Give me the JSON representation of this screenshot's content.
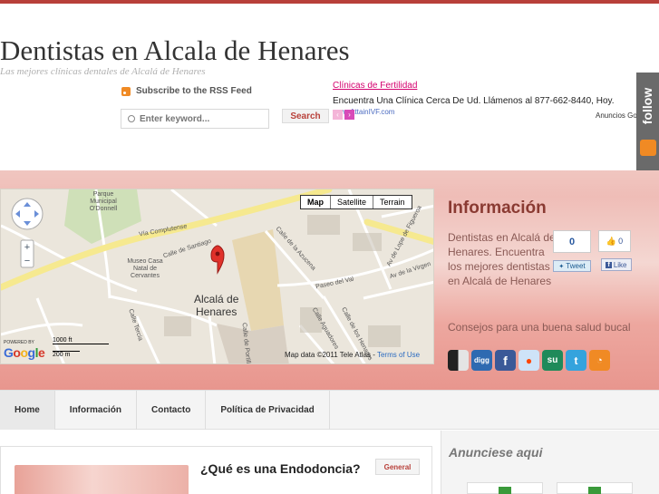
{
  "site": {
    "title": "Dentistas en Alcala de Henares",
    "tagline": "Las mejores clínicas dentales de Alcalá de Henares"
  },
  "header": {
    "rss_label": "Subscribe to the RSS Feed",
    "search_placeholder": "Enter keyword...",
    "search_button": "Search"
  },
  "ad": {
    "title": "Clínicas de Fertilidad",
    "text": "Encuentra Una Clínica Cerca De Ud. Llámenos al 877-662-8440, Hoy.",
    "url": "www.AttainIVF.com",
    "label": "Anuncios Google"
  },
  "follow": {
    "label": "follow"
  },
  "map": {
    "type_buttons": [
      "Map",
      "Satellite",
      "Terrain"
    ],
    "city": [
      "Alcalá de",
      "Henares"
    ],
    "labels": {
      "park": "Parque Municipal O'Donnell",
      "via": "Vía Complutense",
      "santiago": "Calle de Santiago",
      "museo": "Museo Casa Natal de Cervantes",
      "azucena": "Calle de la Azucena",
      "paseo": "Paseo del Val",
      "virgen": "Av de la Virgen",
      "lope": "Av de Lope de Figueroa",
      "tercia": "Calle Tercia",
      "portilla": "Calle de Portilla",
      "aguadores": "Calle Aguadores",
      "henares": "Calle de los Henares"
    },
    "powered": "POWERED BY",
    "google": "Google",
    "scale_ft": "1000 ft",
    "scale_m": "200 m",
    "credit": "Map data ©2011 Tele Atlas -",
    "terms": "Terms of Use"
  },
  "info": {
    "heading": "Información",
    "text": "Dentistas en Alcalá de Henares. Encuentra los mejores dentistas en Alcalá de Henares",
    "link": "Consejos para una buena salud bucal",
    "tweet_count": "0",
    "tweet_label": "Tweet",
    "like_count": "0",
    "like_label": "Like"
  },
  "social": [
    "del.icio.us",
    "digg",
    "facebook",
    "reddit",
    "stumbleupon",
    "twitter",
    "rss"
  ],
  "nav": {
    "items": [
      "Home",
      "Información",
      "Contacto",
      "Política de Privacidad"
    ]
  },
  "post": {
    "title": "¿Qué es una Endodoncia?",
    "category": "General"
  },
  "sidebar": {
    "title": "Anunciese aqui"
  },
  "colors": {
    "accent": "#b8403a",
    "hero": "#efbdb7",
    "ad_link": "#d4006e"
  }
}
